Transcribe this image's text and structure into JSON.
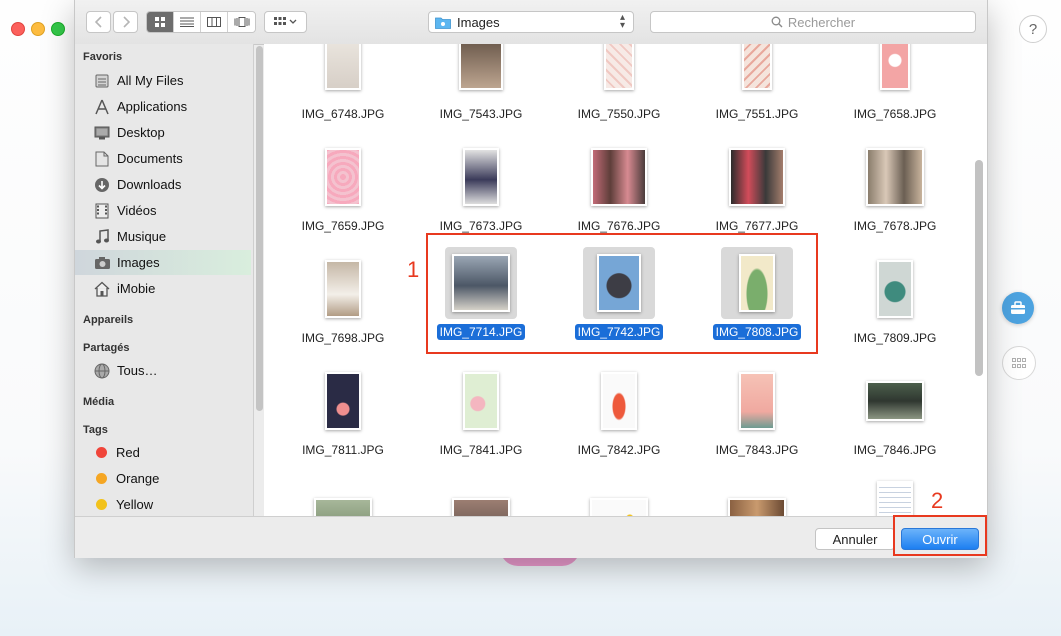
{
  "toolbar": {
    "location": "Images",
    "search_placeholder": "Rechercher"
  },
  "sidebar": {
    "sections": {
      "favoris": "Favoris",
      "appareils": "Appareils",
      "partages": "Partagés",
      "media": "Média",
      "tags": "Tags"
    },
    "favorites": [
      {
        "label": "All My Files",
        "icon": "all-files-icon"
      },
      {
        "label": "Applications",
        "icon": "applications-icon"
      },
      {
        "label": "Desktop",
        "icon": "desktop-icon"
      },
      {
        "label": "Documents",
        "icon": "documents-icon"
      },
      {
        "label": "Downloads",
        "icon": "downloads-icon"
      },
      {
        "label": "Vidéos",
        "icon": "videos-icon"
      },
      {
        "label": "Musique",
        "icon": "music-icon"
      },
      {
        "label": "Images",
        "icon": "camera-icon"
      },
      {
        "label": "iMobie",
        "icon": "home-icon"
      }
    ],
    "shared": [
      {
        "label": "Tous…",
        "icon": "network-icon"
      }
    ],
    "tags": [
      {
        "label": "Red",
        "color": "#f0453a"
      },
      {
        "label": "Orange",
        "color": "#f5a623"
      },
      {
        "label": "Yellow",
        "color": "#f2c21b"
      }
    ]
  },
  "files": [
    {
      "name": "IMG_6748.JPG",
      "selected": false
    },
    {
      "name": "IMG_7543.JPG",
      "selected": false
    },
    {
      "name": "IMG_7550.JPG",
      "selected": false
    },
    {
      "name": "IMG_7551.JPG",
      "selected": false
    },
    {
      "name": "IMG_7658.JPG",
      "selected": false
    },
    {
      "name": "IMG_7659.JPG",
      "selected": false
    },
    {
      "name": "IMG_7673.JPG",
      "selected": false
    },
    {
      "name": "IMG_7676.JPG",
      "selected": false
    },
    {
      "name": "IMG_7677.JPG",
      "selected": false
    },
    {
      "name": "IMG_7678.JPG",
      "selected": false
    },
    {
      "name": "IMG_7698.JPG",
      "selected": false
    },
    {
      "name": "IMG_7714.JPG",
      "selected": true
    },
    {
      "name": "IMG_7742.JPG",
      "selected": true
    },
    {
      "name": "IMG_7808.JPG",
      "selected": true
    },
    {
      "name": "IMG_7809.JPG",
      "selected": false
    },
    {
      "name": "IMG_7811.JPG",
      "selected": false
    },
    {
      "name": "IMG_7841.JPG",
      "selected": false
    },
    {
      "name": "IMG_7842.JPG",
      "selected": false
    },
    {
      "name": "IMG_7843.JPG",
      "selected": false
    },
    {
      "name": "IMG_7846.JPG",
      "selected": false
    }
  ],
  "footer": {
    "cancel_label": "Annuler",
    "open_label": "Ouvrir"
  },
  "annotations": {
    "step1": "1",
    "step2": "2"
  },
  "help_label": "?"
}
